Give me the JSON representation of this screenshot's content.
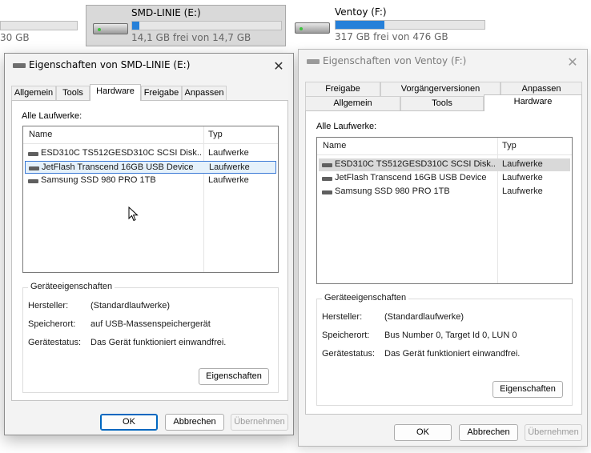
{
  "explorer": {
    "drive_partial": {
      "cap_text": "30 GB"
    },
    "drive_smd": {
      "name": "SMD-LINIE (E:)",
      "cap_text": "14,1 GB frei von 14,7 GB",
      "used_fraction": 0.05
    },
    "drive_ventoy": {
      "name": "Ventoy (F:)",
      "cap_text": "317 GB frei von 476 GB",
      "used_fraction": 0.33
    }
  },
  "dialog_smd": {
    "title": "Eigenschaften von SMD-LINIE (E:)",
    "close_glyph": "✕",
    "tabs": [
      "Allgemein",
      "Tools",
      "Hardware",
      "Freigabe",
      "Anpassen"
    ],
    "active_tab": "Hardware",
    "all_drives_label": "Alle Laufwerke:",
    "columns": [
      "Name",
      "Typ"
    ],
    "rows": [
      {
        "name": "ESD310C TS512GESD310C SCSI Disk...",
        "type": "Laufwerke"
      },
      {
        "name": "JetFlash Transcend 16GB USB Device",
        "type": "Laufwerke"
      },
      {
        "name": "Samsung SSD 980 PRO 1TB",
        "type": "Laufwerke"
      }
    ],
    "group_title": "Geräteeigenschaften",
    "props": [
      {
        "key": "Hersteller:",
        "value": "(Standardlaufwerke)"
      },
      {
        "key": "Speicherort:",
        "value": "auf USB-Massenspeichergerät"
      },
      {
        "key": "Gerätestatus:",
        "value": "Das Gerät funktioniert einwandfrei."
      }
    ],
    "properties_button": "Eigenschaften",
    "ok": "OK",
    "cancel": "Abbrechen",
    "apply": "Übernehmen"
  },
  "dialog_ventoy": {
    "title": "Eigenschaften von Ventoy (F:)",
    "close_glyph": "✕",
    "tabs_row1": [
      "Freigabe",
      "Vorgängerversionen",
      "Anpassen"
    ],
    "tabs_row2": [
      "Allgemein",
      "Tools",
      "Hardware"
    ],
    "active_tab": "Hardware",
    "all_drives_label": "Alle Laufwerke:",
    "columns": [
      "Name",
      "Typ"
    ],
    "rows": [
      {
        "name": "ESD310C TS512GESD310C SCSI Disk...",
        "type": "Laufwerke"
      },
      {
        "name": "JetFlash Transcend 16GB USB Device",
        "type": "Laufwerke"
      },
      {
        "name": "Samsung SSD 980 PRO 1TB",
        "type": "Laufwerke"
      }
    ],
    "group_title": "Geräteeigenschaften",
    "props": [
      {
        "key": "Hersteller:",
        "value": "(Standardlaufwerke)"
      },
      {
        "key": "Speicherort:",
        "value": "Bus Number 0, Target Id 0, LUN 0"
      },
      {
        "key": "Gerätestatus:",
        "value": "Das Gerät funktioniert einwandfrei."
      }
    ],
    "properties_button": "Eigenschaften",
    "ok": "OK",
    "cancel": "Abbrechen",
    "apply": "Übernehmen"
  },
  "colors": {
    "accent": "#0067c0",
    "capacity_fill": "#2680d9",
    "selection_border": "#3d7bd6"
  }
}
